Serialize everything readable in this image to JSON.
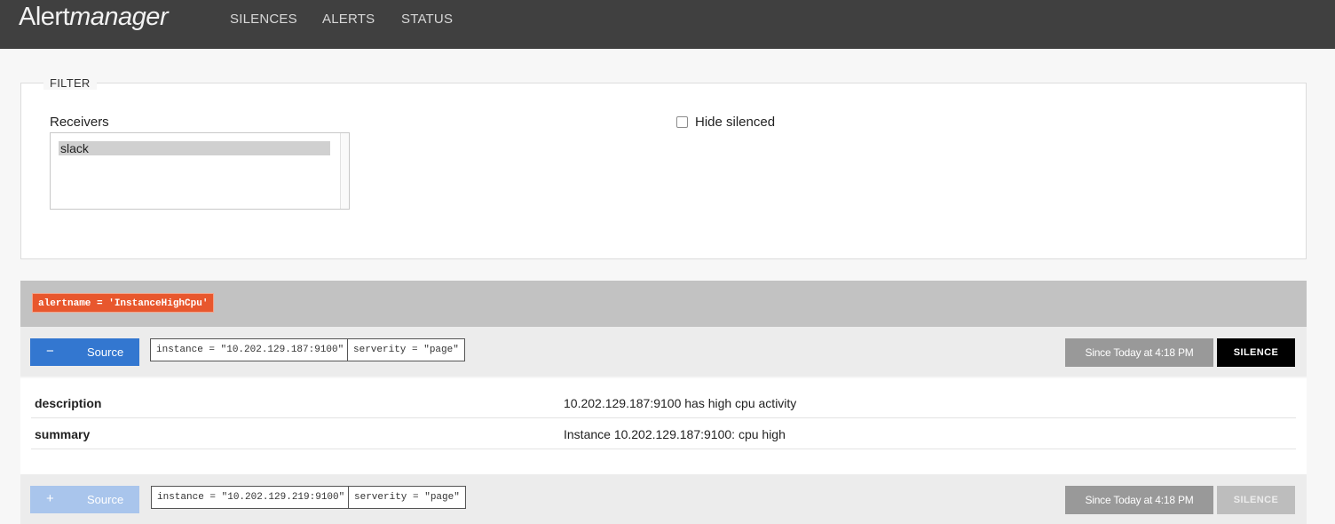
{
  "app": {
    "logo_plain": "Alert",
    "logo_italic": "manager",
    "nav": [
      "SILENCES",
      "ALERTS",
      "STATUS"
    ]
  },
  "filter": {
    "legend": "FILTER",
    "receivers_label": "Receivers",
    "receivers_options": [
      "slack"
    ],
    "receivers_selected": "slack",
    "hide_silenced_label": "Hide silenced",
    "hide_silenced_checked": false
  },
  "group": {
    "label": "alertname = 'InstanceHighCpu'",
    "accent": "#e8572d"
  },
  "alerts": [
    {
      "expanded": true,
      "toggle_sign": "−",
      "source_label": "Source",
      "labels": [
        "instance = \"10.202.129.187:9100\"",
        "serverity = \"page\""
      ],
      "since": "Since Today at 4:18 PM",
      "silence_label": "SILENCE",
      "annotations": [
        {
          "key": "description",
          "value": "10.202.129.187:9100 has high cpu activity"
        },
        {
          "key": "summary",
          "value": "Instance 10.202.129.187:9100: cpu high"
        }
      ]
    },
    {
      "expanded": false,
      "toggle_sign": "+",
      "source_label": "Source",
      "labels": [
        "instance = \"10.202.129.219:9100\"",
        "serverity = \"page\""
      ],
      "since": "Since Today at 4:18 PM",
      "silence_label": "SILENCE"
    }
  ],
  "colors": {
    "topbar": "#404040",
    "source_button": "#3377d0",
    "silence_button": "#000000"
  }
}
